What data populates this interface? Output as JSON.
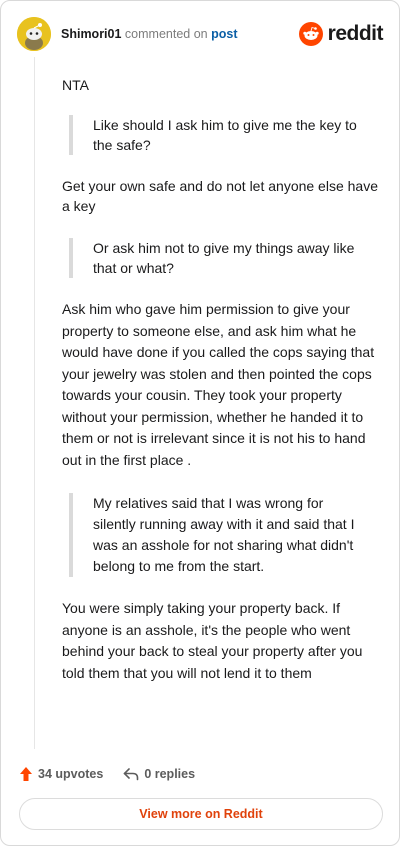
{
  "comment": {
    "username": "Shimori01",
    "action_text": "commented on",
    "post_link": "post",
    "brand": "reddit",
    "blocks": [
      {
        "type": "text",
        "text": "NTA"
      },
      {
        "type": "quote",
        "text": "Like should I ask him to give me the key to the safe?"
      },
      {
        "type": "text",
        "text": "Get your own safe and do not let anyone else have a key"
      },
      {
        "type": "quote",
        "text": "Or ask him not to give my things away like that or what?"
      },
      {
        "type": "text",
        "text": "Ask him who gave him permission to give your property to someone else, and ask him what he would have done if you called the cops saying that your jewelry was stolen and then pointed the cops towards your cousin. They took your property without your permission, whether he handed it to them or not is irrelevant since it is not his to hand out in the first place ."
      },
      {
        "type": "quote",
        "text": "My relatives said that I was wrong for silently running away with it and said that I was an asshole for not sharing what didn't belong to me from the start."
      },
      {
        "type": "text",
        "text": "You were simply taking your property back. If anyone is an asshole, it's the people who went behind your back to steal your property after you told them that you will not lend it to them"
      }
    ]
  },
  "actions": {
    "upvotes": "34 upvotes",
    "replies": "0 replies"
  },
  "footer": {
    "view_more": "View more on Reddit"
  },
  "colors": {
    "brand_orange": "#ff4500",
    "link_blue": "#0b5fa6",
    "avatar_yellow": "#e8c21f"
  },
  "icons": {
    "avatar": "snoo-avatar-icon",
    "brand": "reddit-logo-icon",
    "upvote": "upvote-arrow-icon",
    "reply": "reply-arrow-icon"
  }
}
